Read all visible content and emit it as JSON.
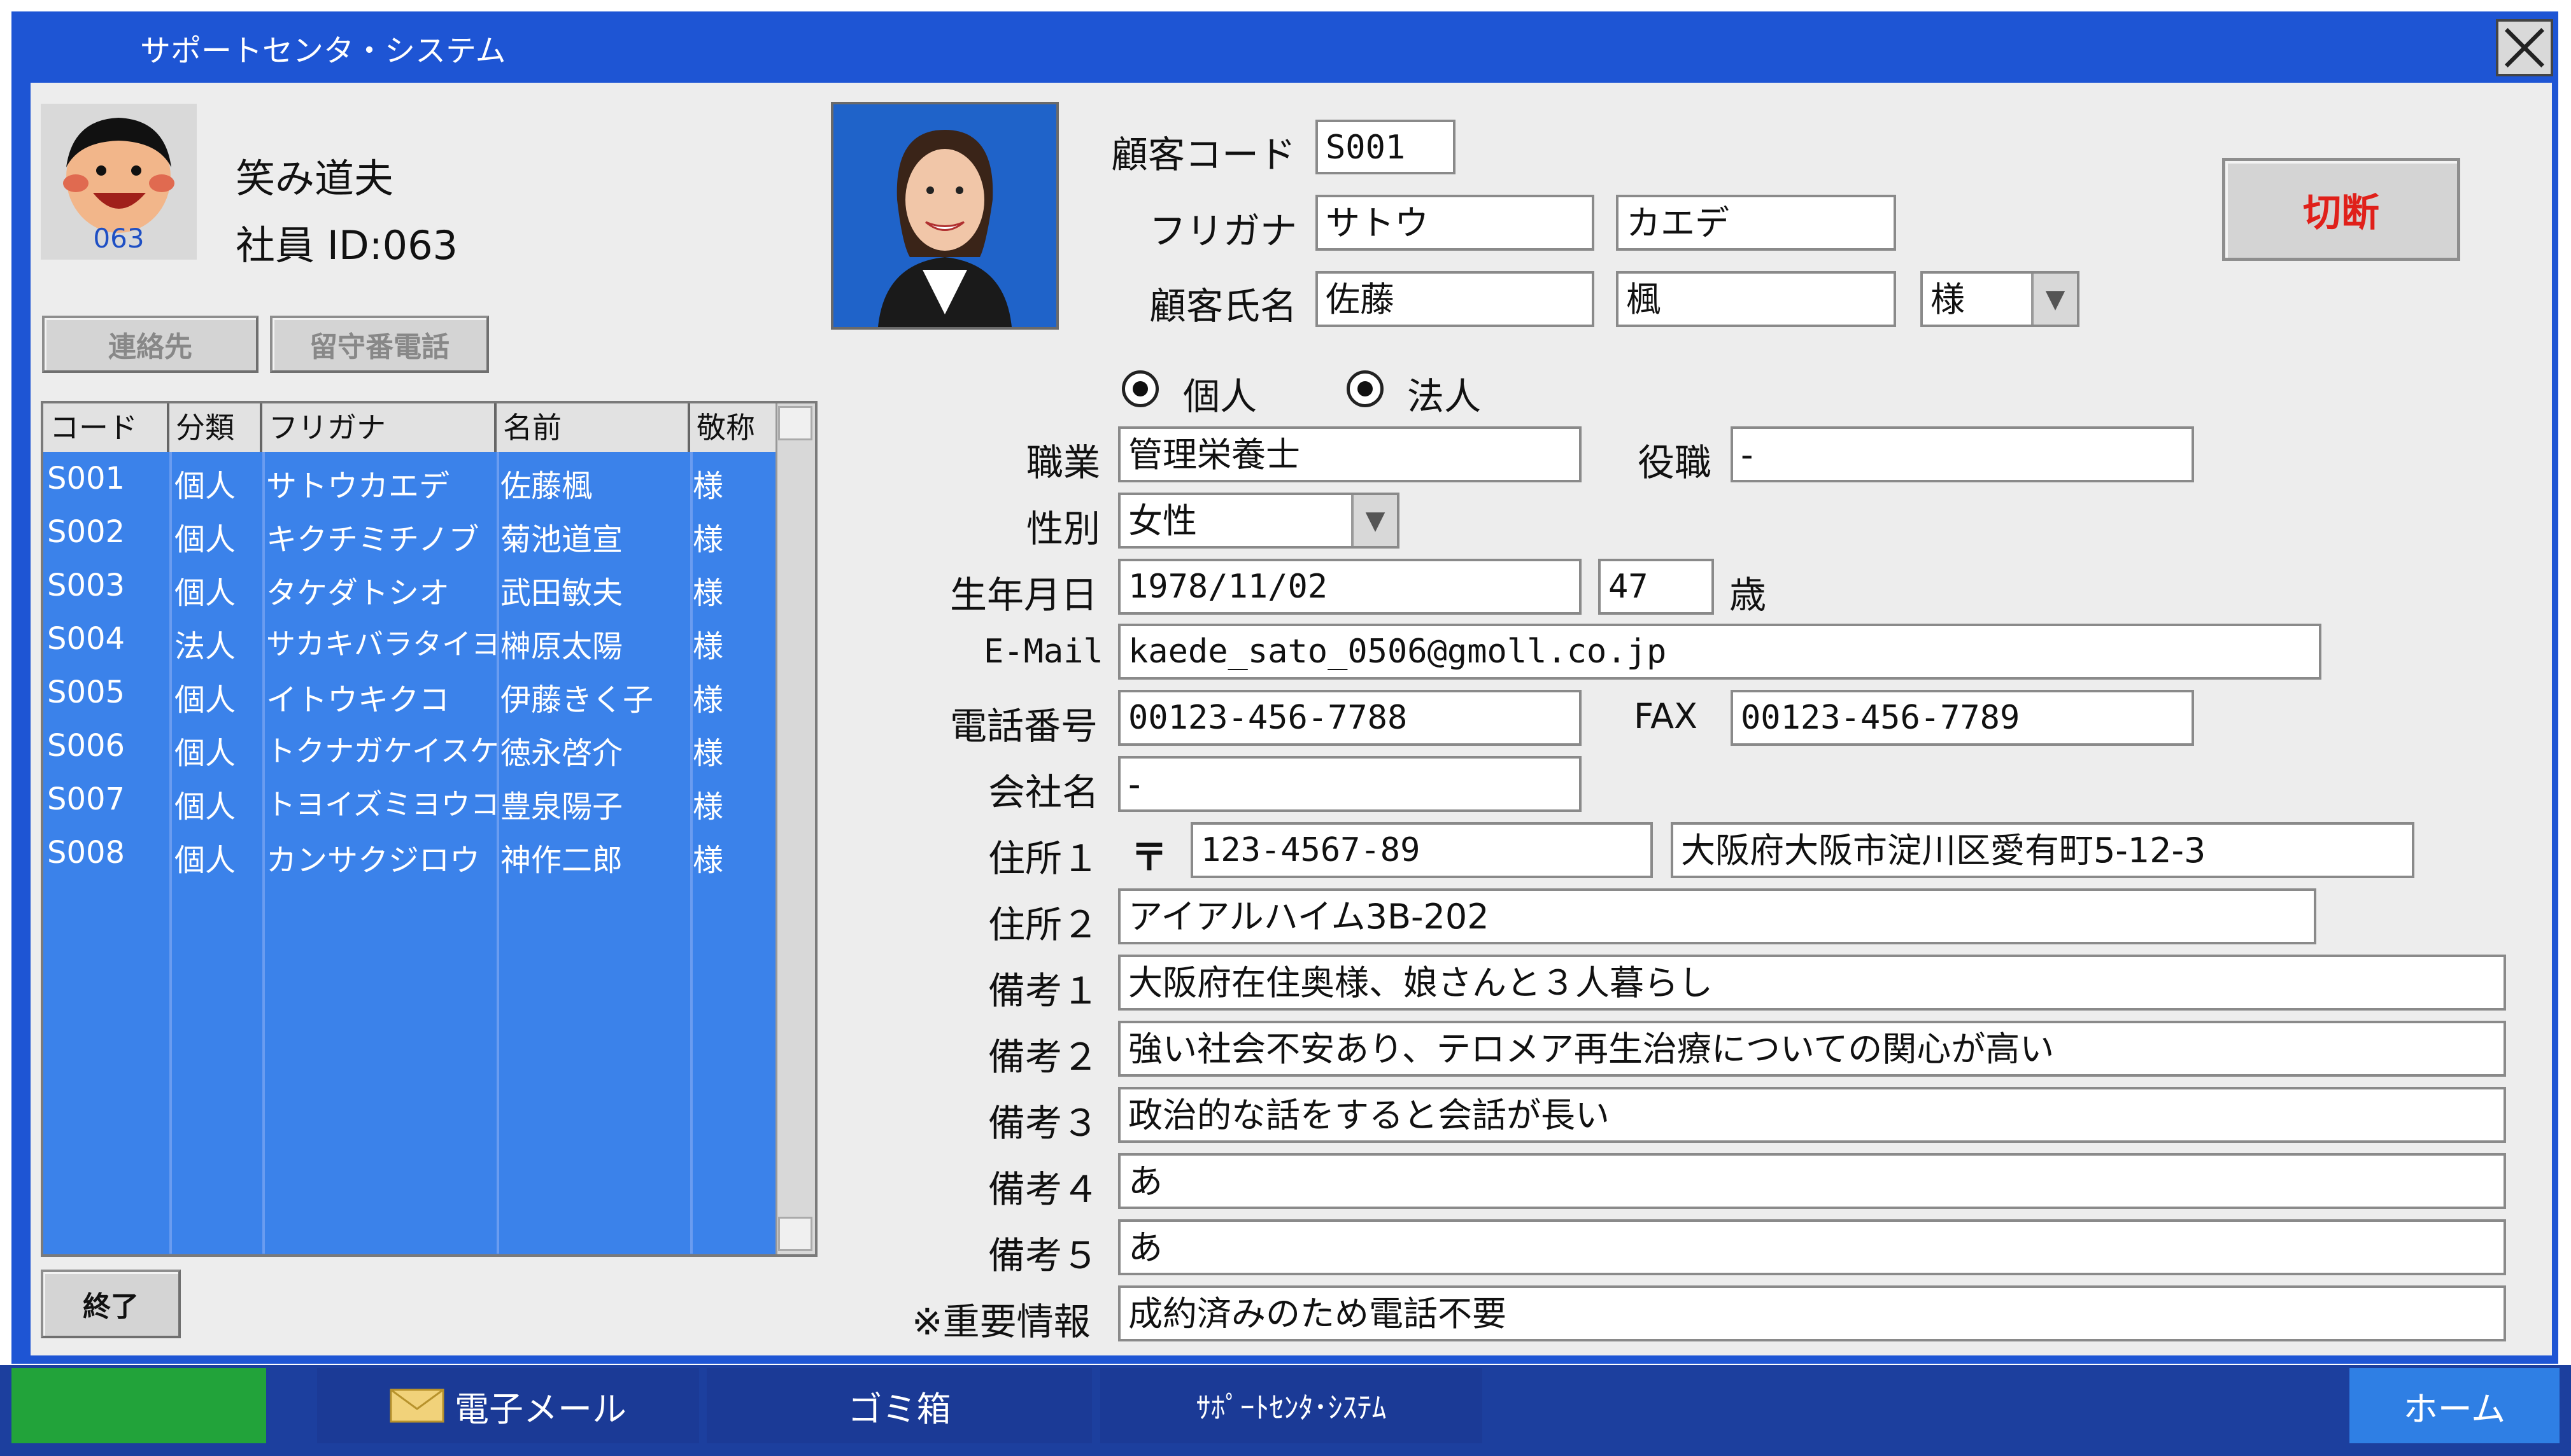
{
  "window": {
    "title": "サポートセンタ・システム"
  },
  "employee": {
    "avatar_id": "063",
    "name": "笑み道夫",
    "id_label": "社員 ID:063"
  },
  "buttons": {
    "contact": "連絡先",
    "voicemail": "留守番電話",
    "exit": "終了",
    "disconnect": "切断"
  },
  "list": {
    "headers": [
      "コード",
      "分類",
      "フリガナ",
      "名前",
      "敬称"
    ],
    "rows": [
      [
        "S001",
        "個人",
        "サトウカエデ",
        "佐藤楓",
        "様"
      ],
      [
        "S002",
        "個人",
        "キクチミチノブ",
        "菊池道宣",
        "様"
      ],
      [
        "S003",
        "個人",
        "タケダトシオ",
        "武田敏夫",
        "様"
      ],
      [
        "S004",
        "法人",
        "サカキバラタイヨ",
        "榊原太陽",
        "様"
      ],
      [
        "S005",
        "個人",
        "イトウキクコ",
        "伊藤きく子",
        "様"
      ],
      [
        "S006",
        "個人",
        "トクナガケイスケ",
        "徳永啓介",
        "様"
      ],
      [
        "S007",
        "個人",
        "トヨイズミヨウコ",
        "豊泉陽子",
        "様"
      ],
      [
        "S008",
        "個人",
        "カンサクジロウ",
        "神作二郎",
        "様"
      ]
    ]
  },
  "form": {
    "customer_code_label": "顧客コード",
    "customer_code": "S001",
    "furigana_label": "フリガナ",
    "furigana_last": "サトウ",
    "furigana_first": "カエデ",
    "name_label": "顧客氏名",
    "name_last": "佐藤",
    "name_first": "楓",
    "honorific": "様",
    "radio_individual": "個人",
    "radio_corporate": "法人",
    "occupation_label": "職業",
    "occupation": "管理栄養士",
    "position_label": "役職",
    "position": "-",
    "gender_label": "性別",
    "gender": "女性",
    "birthdate_label": "生年月日",
    "birthdate": "1978/11/02",
    "age": "47",
    "age_unit": "歳",
    "email_label": "E-Mail",
    "email": "kaede_sato_0506@gmoll.co.jp",
    "phone_label": "電話番号",
    "phone": "00123-456-7788",
    "fax_label": "FAX",
    "fax": "00123-456-7789",
    "company_label": "会社名",
    "company": "-",
    "address1_label": "住所１",
    "postal_mark": "〒",
    "postal_code": "123-4567-89",
    "address1": "大阪府大阪市淀川区愛有町5-12-3",
    "address2_label": "住所２",
    "address2": "アイアルハイム3B-202",
    "note1_label": "備考１",
    "note1": "大阪府在住奥様、娘さんと３人暮らし",
    "note2_label": "備考２",
    "note2": "強い社会不安あり、テロメア再生治療についての関心が高い",
    "note3_label": "備考３",
    "note3": "政治的な話をすると会話が長い",
    "note4_label": "備考４",
    "note4": "あ",
    "note5_label": "備考５",
    "note5": "あ",
    "important_label": "※重要情報",
    "important": "成約済みのため電話不要"
  },
  "taskbar": {
    "email": "電子メール",
    "trash": "ゴミ箱",
    "app": "ｻﾎﾟｰﾄｾﾝﾀ･ｼｽﾃﾑ",
    "home": "ホーム"
  },
  "colors": {
    "titlebar": "#1e55d4",
    "list_bg": "#3b82ea",
    "taskbar": "#1c3f9e",
    "disconnect_text": "#e0201a",
    "start_green": "#22a33a"
  }
}
